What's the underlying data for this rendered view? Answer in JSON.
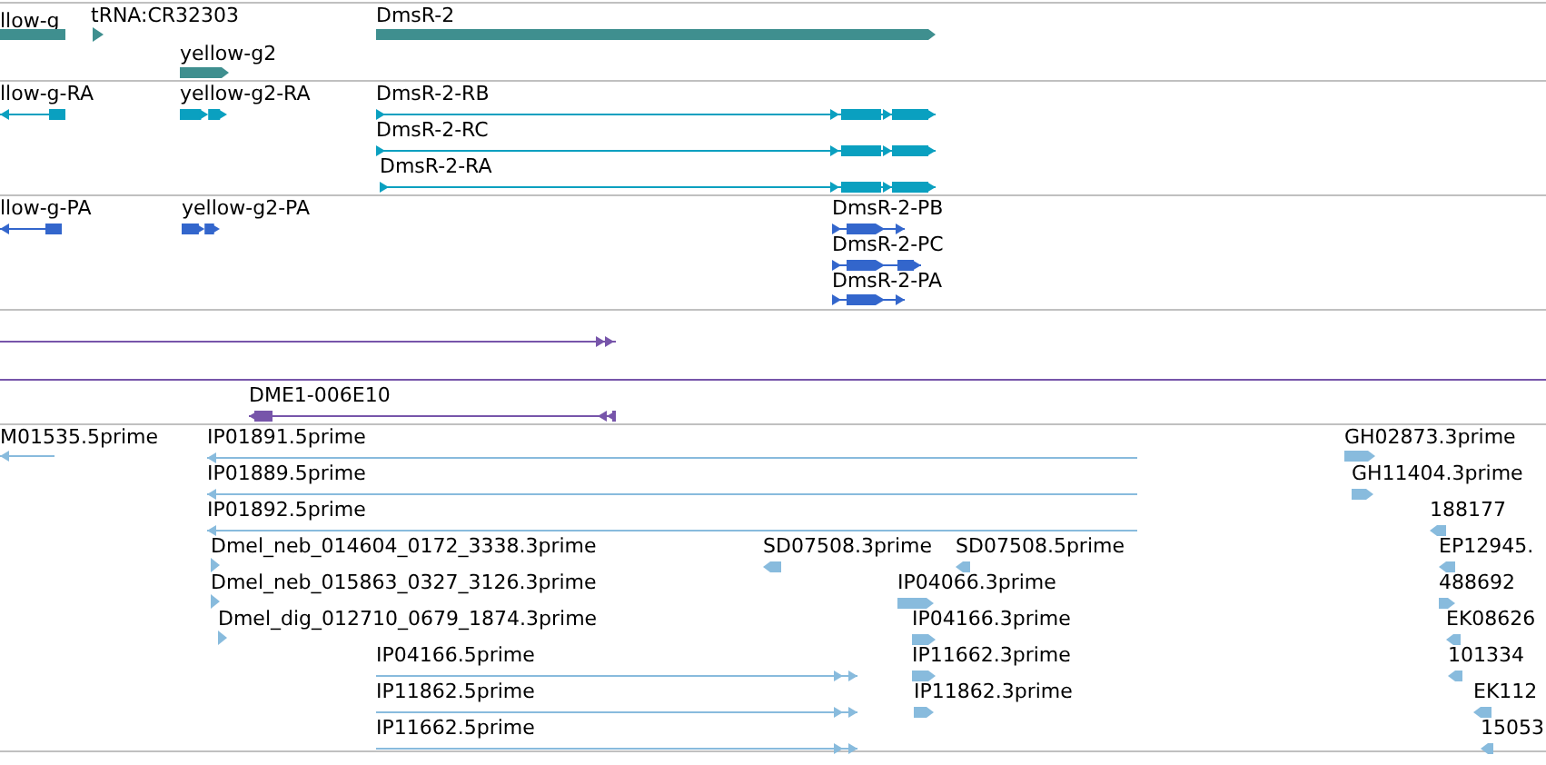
{
  "tracks": [
    {
      "color": "#3f8f8f",
      "features": [
        {
          "label": "llow-g"
        },
        {
          "label": "tRNA:CR32303"
        },
        {
          "label": "DmsR-2"
        },
        {
          "label": "yellow-g2"
        }
      ]
    },
    {
      "color": "#0aa0c0",
      "features": [
        {
          "label": "llow-g-RA"
        },
        {
          "label": "yellow-g2-RA"
        },
        {
          "label": "DmsR-2-RB"
        },
        {
          "label": "DmsR-2-RC"
        },
        {
          "label": "DmsR-2-RA"
        }
      ]
    },
    {
      "color": "#3366cc",
      "features": [
        {
          "label": "llow-g-PA"
        },
        {
          "label": "yellow-g2-PA"
        },
        {
          "label": "DmsR-2-PB"
        },
        {
          "label": "DmsR-2-PC"
        },
        {
          "label": "DmsR-2-PA"
        }
      ]
    },
    {
      "color": "#7755aa",
      "features": [
        {
          "label": "DME1-006E10"
        }
      ]
    },
    {
      "color": "#88bbdd",
      "features": [
        {
          "label": "M01535.5prime"
        },
        {
          "label": "IP01891.5prime"
        },
        {
          "label": "GH02873.3prime"
        },
        {
          "label": "IP01889.5prime"
        },
        {
          "label": "GH11404.3prime"
        },
        {
          "label": "IP01892.5prime"
        },
        {
          "label": "188177"
        },
        {
          "label": "Dmel_neb_014604_0172_3338.3prime"
        },
        {
          "label": "SD07508.3prime"
        },
        {
          "label": "SD07508.5prime"
        },
        {
          "label": "EP12945."
        },
        {
          "label": "Dmel_neb_015863_0327_3126.3prime"
        },
        {
          "label": "IP04066.3prime"
        },
        {
          "label": "488692"
        },
        {
          "label": "Dmel_dig_012710_0679_1874.3prime"
        },
        {
          "label": "IP04166.3prime"
        },
        {
          "label": "EK08626"
        },
        {
          "label": "IP04166.5prime"
        },
        {
          "label": "IP11662.3prime"
        },
        {
          "label": "101334"
        },
        {
          "label": "IP11862.5prime"
        },
        {
          "label": "IP11862.3prime"
        },
        {
          "label": "EK112"
        },
        {
          "label": "IP11662.5prime"
        },
        {
          "label": "15053"
        }
      ]
    }
  ]
}
